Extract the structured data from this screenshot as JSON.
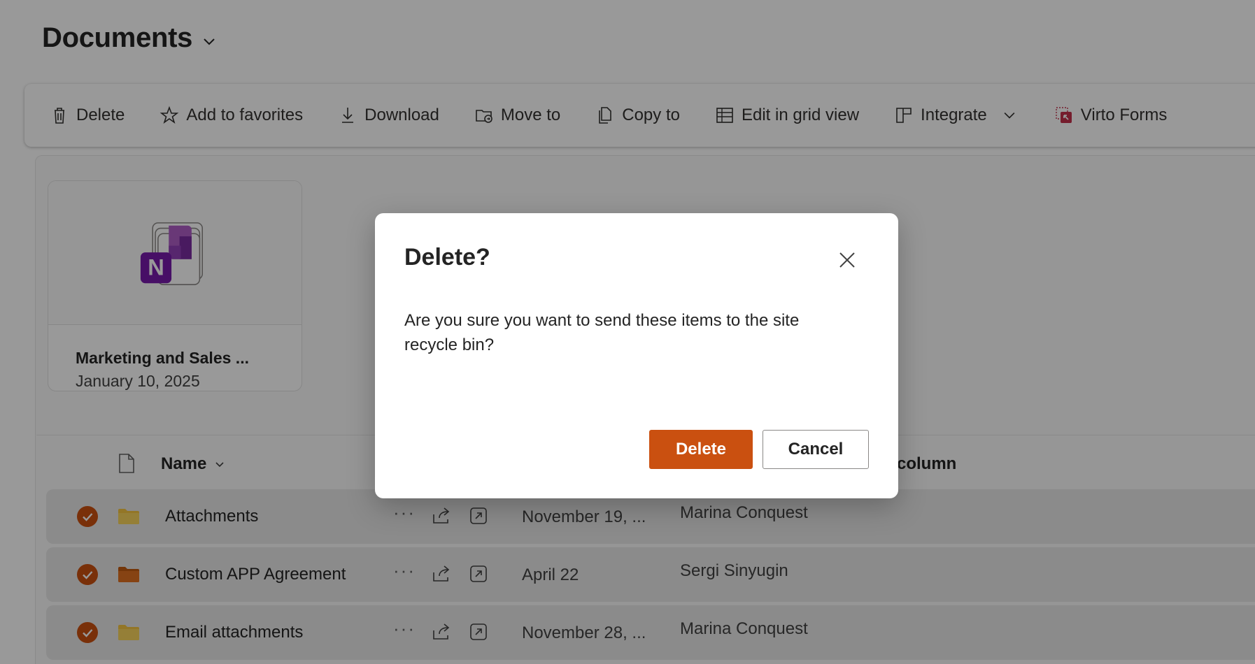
{
  "header": {
    "title": "Documents"
  },
  "toolbar": {
    "items": [
      {
        "label": "Delete",
        "icon": "trash-icon"
      },
      {
        "label": "Add to favorites",
        "icon": "star-icon"
      },
      {
        "label": "Download",
        "icon": "download-icon"
      },
      {
        "label": "Move to",
        "icon": "folder-move-icon"
      },
      {
        "label": "Copy to",
        "icon": "copy-icon"
      },
      {
        "label": "Edit in grid view",
        "icon": "grid-icon"
      },
      {
        "label": "Integrate",
        "icon": "integrate-icon"
      },
      {
        "label": "Virto Forms",
        "icon": "virto-forms-icon"
      }
    ]
  },
  "card": {
    "name": "Marketing and Sales ...",
    "date": "January 10, 2025",
    "icon": "onenote-icon",
    "icon_letter": "N"
  },
  "list": {
    "columns": {
      "name": "Name",
      "custom": "column"
    },
    "rows": [
      {
        "name": "Attachments",
        "modified": "November 19, ...",
        "modified_by": "Marina Conquest",
        "folder_color": "#f5c542"
      },
      {
        "name": "Custom APP Agreement",
        "modified": "April 22",
        "modified_by": "Sergi Sinyugin",
        "folder_color": "#d86a14"
      },
      {
        "name": "Email attachments",
        "modified": "November 28, ...",
        "modified_by": "Marina Conquest",
        "folder_color": "#f5c542"
      }
    ],
    "more_glyph": "···"
  },
  "dialog": {
    "title": "Delete?",
    "message": "Are you sure you want to send these items to the site recycle bin?",
    "primary_label": "Delete",
    "secondary_label": "Cancel"
  },
  "colors": {
    "accent": "#ca5010",
    "overlay": "rgba(0,0,0,0.4)"
  }
}
